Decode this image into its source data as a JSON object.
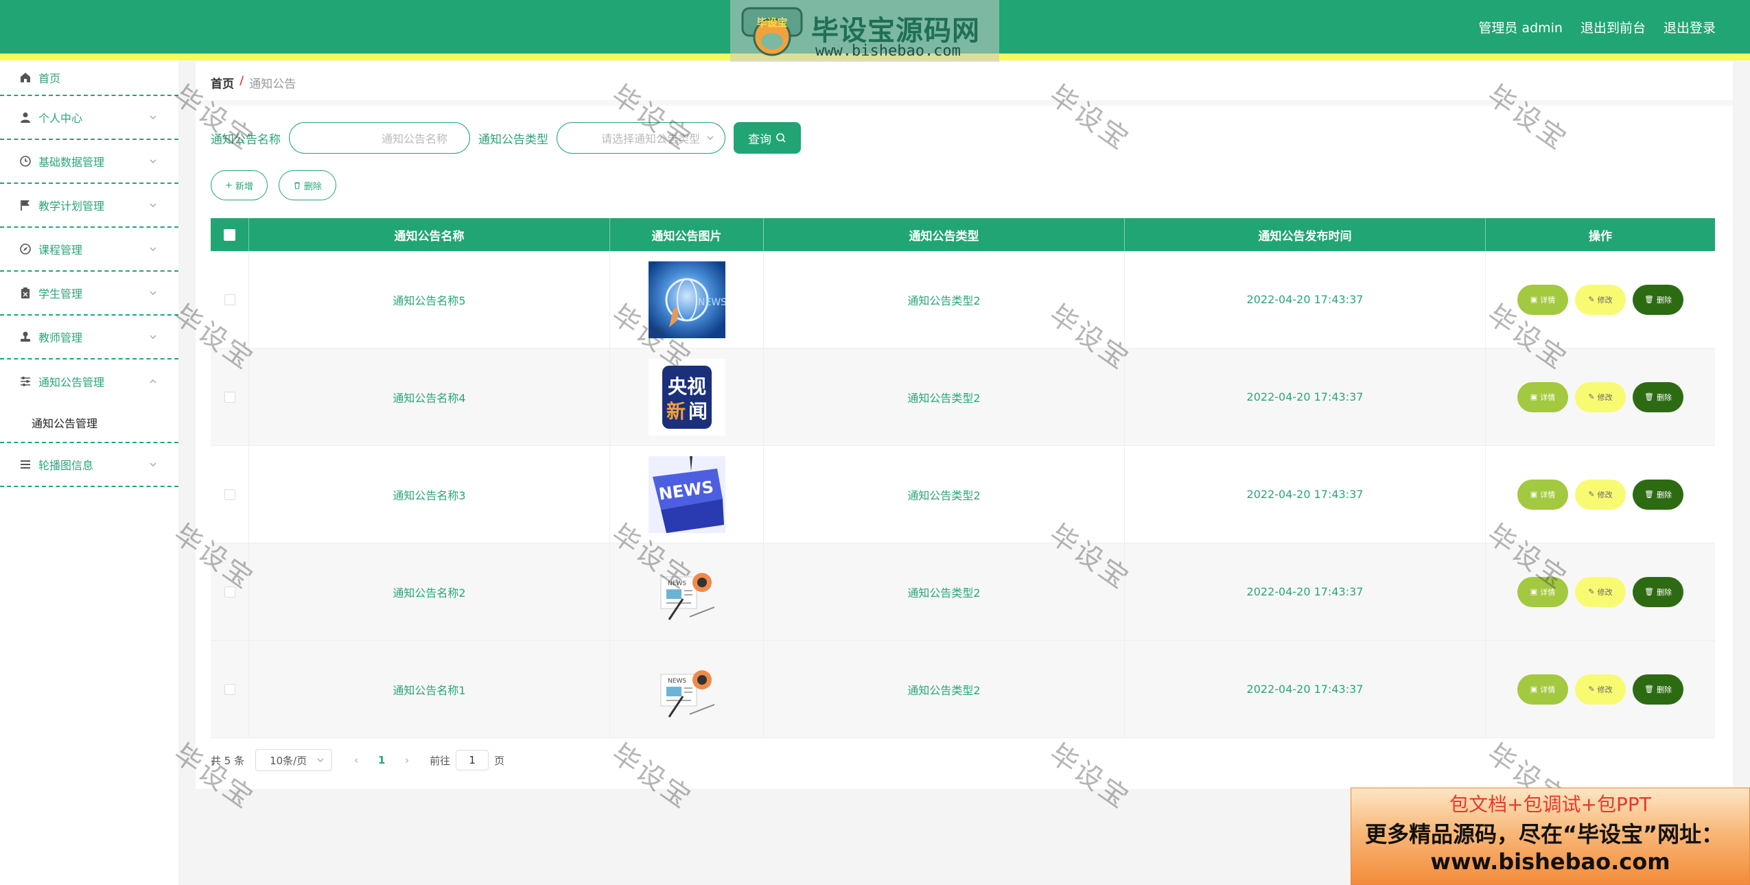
{
  "header": {
    "admin_label": "管理员 admin",
    "to_front": "退出到前台",
    "logout": "退出登录",
    "logo_title": "毕设宝源码网",
    "logo_badge": "毕设宝",
    "logo_url": "www.bishebao.com",
    "color": "#21a574",
    "strip_color": "#f6f95e"
  },
  "sidebar": {
    "items": [
      {
        "label": "首页",
        "icon": "home-icon"
      },
      {
        "label": "个人中心",
        "icon": "user-icon"
      },
      {
        "label": "基础数据管理",
        "icon": "clock-icon"
      },
      {
        "label": "教学计划管理",
        "icon": "flag-icon"
      },
      {
        "label": "课程管理",
        "icon": "compass-icon"
      },
      {
        "label": "学生管理",
        "icon": "clipboard-icon"
      },
      {
        "label": "教师管理",
        "icon": "stamp-icon"
      },
      {
        "label": "通知公告管理",
        "icon": "sliders-icon"
      },
      {
        "label": "轮播图信息",
        "icon": "menu-icon"
      }
    ],
    "submenu_label": "通知公告管理"
  },
  "breadcrumb": {
    "home": "首页",
    "separator": "/",
    "current": "通知公告"
  },
  "search": {
    "name_label": "通知公告名称",
    "name_placeholder": "通知公告名称",
    "type_label": "通知公告类型",
    "type_placeholder": "请选择通知公告类型",
    "query_button": "查询"
  },
  "actions": {
    "add": "新增",
    "delete": "删除"
  },
  "table": {
    "columns": [
      "通知公告名称",
      "通知公告图片",
      "通知公告类型",
      "通知公告发布时间",
      "操作"
    ],
    "rows": [
      {
        "name": "通知公告名称5",
        "image": "news-globe-image",
        "type": "通知公告类型2",
        "time": "2022-04-20 17:43:37"
      },
      {
        "name": "通知公告名称4",
        "image": "cctv-news-image",
        "type": "通知公告类型2",
        "time": "2022-04-20 17:43:37"
      },
      {
        "name": "通知公告名称3",
        "image": "news-key-image",
        "type": "通知公告类型2",
        "time": "2022-04-20 17:43:37"
      },
      {
        "name": "通知公告名称2",
        "image": "newspaper-image",
        "type": "通知公告类型2",
        "time": "2022-04-20 17:43:37"
      },
      {
        "name": "通知公告名称1",
        "image": "newspaper-image",
        "type": "通知公告类型2",
        "time": "2022-04-20 17:43:37"
      }
    ],
    "op_detail": "详情",
    "op_edit": "修改",
    "op_delete": "删除"
  },
  "pagination": {
    "total": "共 5 条",
    "page_size": "10条/页",
    "current_page": "1",
    "goto_prefix": "前往",
    "goto_value": "1",
    "goto_suffix": "页"
  },
  "watermark": "毕设宝",
  "promo": {
    "line1": "包文档+包调试+包PPT",
    "line2": "更多精品源码，尽在“毕设宝”网址：",
    "line3": "www.bishebao.com"
  }
}
